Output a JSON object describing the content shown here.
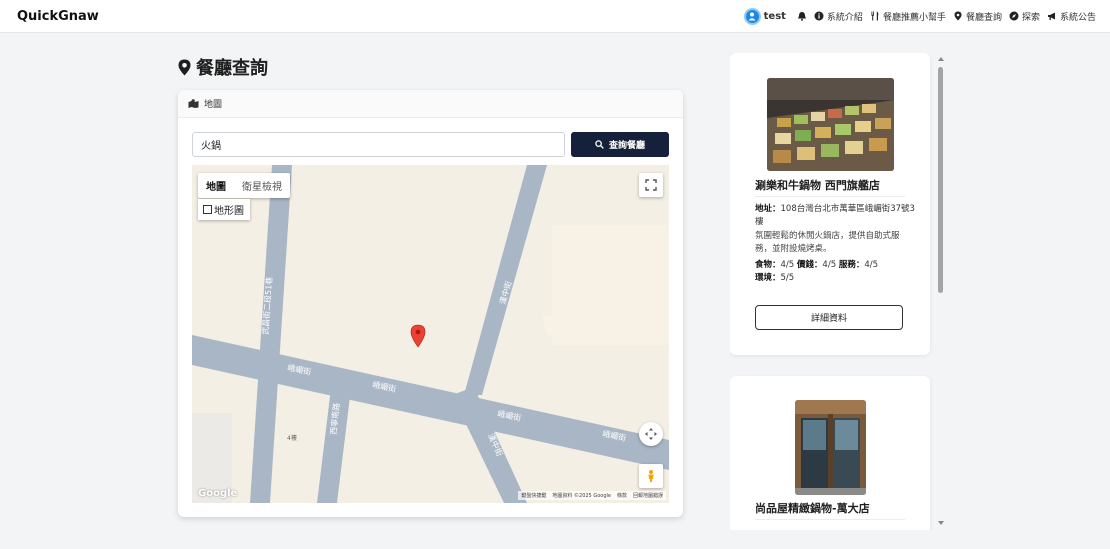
{
  "app": {
    "brand": "QuickGnaw"
  },
  "nav": {
    "user": "test",
    "items": [
      {
        "label": "系統介紹",
        "icon": "info-circle-icon"
      },
      {
        "label": "餐廳推薦小幫手",
        "icon": "utensils-icon"
      },
      {
        "label": "餐廳查詢",
        "icon": "map-pin-icon"
      },
      {
        "label": "探索",
        "icon": "compass-icon"
      },
      {
        "label": "系統公告",
        "icon": "megaphone-icon"
      }
    ]
  },
  "page": {
    "title": "餐廳查詢"
  },
  "map_card": {
    "header": "地圖",
    "search_value": "火鍋",
    "search_button": "查詢餐廳",
    "map_types": [
      "地圖",
      "衛星檢視"
    ],
    "terrain_label": "地形圖",
    "google": "Google",
    "attribution": [
      "鍵盤快捷鍵",
      "地圖資料 ©2025 Google",
      "條款",
      "回報地圖錯誤"
    ]
  },
  "results": [
    {
      "name": "涮樂和牛鍋物 西門旗艦店",
      "address_label": "地址：",
      "address": "108台灣台北市萬華區峨嵋街37號3樓",
      "description": "氛圍輕鬆的休閒火鍋店，提供自助式服務，並附設燒烤桌。",
      "food_label": "食物：",
      "food": "4/5",
      "price_label": "價錢：",
      "price": "4/5",
      "service_label": "服務：",
      "service": "4/5",
      "env_label": "環境：",
      "env": "5/5",
      "detail_button": "詳細資料"
    },
    {
      "name": "尚品屋精緻鍋物-萬大店"
    }
  ]
}
